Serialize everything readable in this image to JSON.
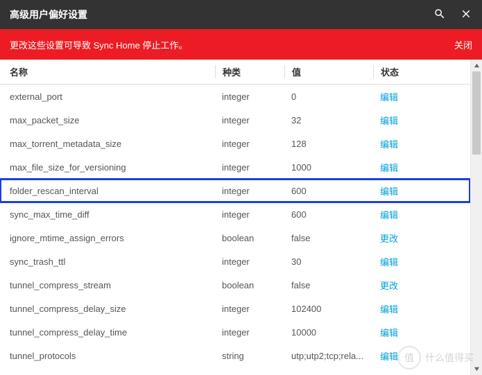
{
  "titlebar": {
    "title": "高级用户偏好设置"
  },
  "warnbar": {
    "text": "更改这些设置可导致 Sync Home 停止工作。",
    "close": "关闭"
  },
  "headers": {
    "name": "名称",
    "type": "种类",
    "value": "值",
    "status": "状态"
  },
  "action_edit": "编辑",
  "action_change": "更改",
  "rows": [
    {
      "name": "external_port",
      "type": "integer",
      "value": "0",
      "action": "edit",
      "highlight": false
    },
    {
      "name": "max_packet_size",
      "type": "integer",
      "value": "32",
      "action": "edit",
      "highlight": false
    },
    {
      "name": "max_torrent_metadata_size",
      "type": "integer",
      "value": "128",
      "action": "edit",
      "highlight": false
    },
    {
      "name": "max_file_size_for_versioning",
      "type": "integer",
      "value": "1000",
      "action": "edit",
      "highlight": false
    },
    {
      "name": "folder_rescan_interval",
      "type": "integer",
      "value": "600",
      "action": "edit",
      "highlight": true
    },
    {
      "name": "sync_max_time_diff",
      "type": "integer",
      "value": "600",
      "action": "edit",
      "highlight": false
    },
    {
      "name": "ignore_mtime_assign_errors",
      "type": "boolean",
      "value": "false",
      "action": "change",
      "highlight": false
    },
    {
      "name": "sync_trash_ttl",
      "type": "integer",
      "value": "30",
      "action": "edit",
      "highlight": false
    },
    {
      "name": "tunnel_compress_stream",
      "type": "boolean",
      "value": "false",
      "action": "change",
      "highlight": false
    },
    {
      "name": "tunnel_compress_delay_size",
      "type": "integer",
      "value": "102400",
      "action": "edit",
      "highlight": false
    },
    {
      "name": "tunnel_compress_delay_time",
      "type": "integer",
      "value": "10000",
      "action": "edit",
      "highlight": false
    },
    {
      "name": "tunnel_protocols",
      "type": "string",
      "value": "utp;utp2;tcp;rela...",
      "action": "edit",
      "highlight": false
    }
  ],
  "watermark": {
    "circle": "值",
    "text": "什么值得买"
  }
}
